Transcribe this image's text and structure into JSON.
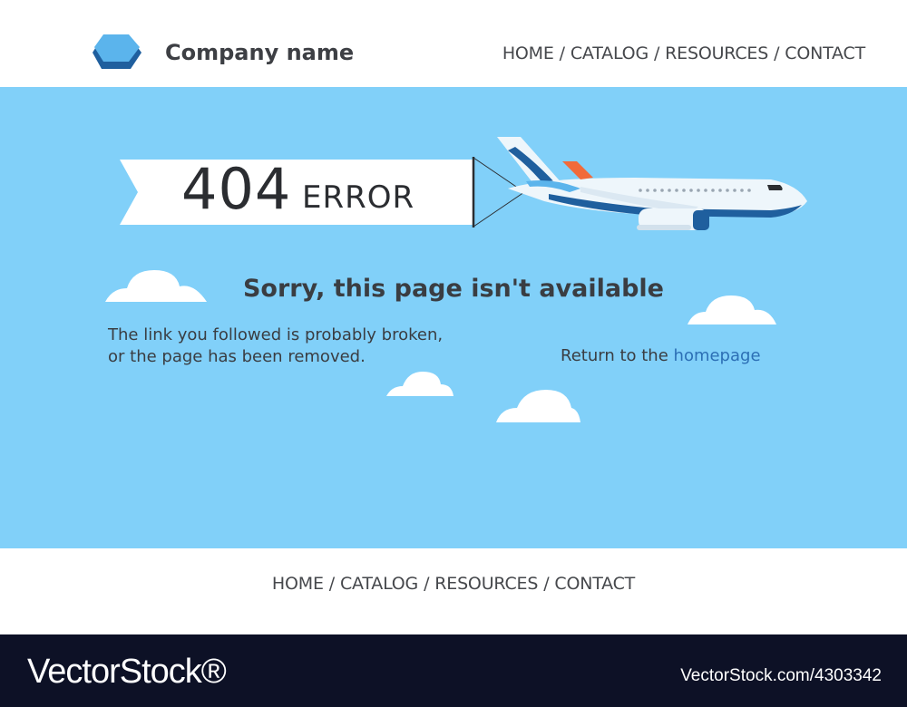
{
  "header": {
    "company_name": "Company name",
    "logo_icon": "hexagon-icon",
    "nav": {
      "home": "HOME",
      "catalog": "CATALOG",
      "resources": "RESOURCES",
      "contact": "CONTACT",
      "separator": "/"
    }
  },
  "hero": {
    "error_code": "404",
    "error_word": "ERROR",
    "illustration": "airplane-towing-banner",
    "headline": "Sorry, this page isn't available",
    "message_line1": "The link you followed is probably broken,",
    "message_line2": "or the page has been removed.",
    "return_text": "Return to the",
    "return_link": "homepage"
  },
  "footer": {
    "nav": {
      "home": "HOME",
      "catalog": "CATALOG",
      "resources": "RESOURCES",
      "contact": "CONTACT",
      "separator": "/"
    }
  },
  "watermark": {
    "brand": "VectorStock®",
    "id": "VectorStock.com/4303342"
  },
  "colors": {
    "sky": "#81d0f9",
    "text_dark": "#3a3d42",
    "link": "#2c6fb5",
    "watermark_bg": "#0d1126"
  }
}
